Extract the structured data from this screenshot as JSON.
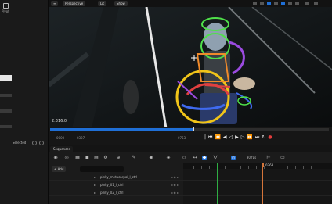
{
  "left_panel": {
    "pivot_label": "Pivot",
    "selected_label": "Selected"
  },
  "viewport": {
    "perspective_label": "Perspective",
    "lit_label": "Lit",
    "show_label": "Show",
    "timecode": "2.316.0",
    "range_start": "0000",
    "range_end": "0327",
    "frame_current": "0753",
    "playback_progress": 0.51
  },
  "sequencer": {
    "tab_label": "Sequencer",
    "add_label": "+ Add",
    "search_placeholder": "",
    "fps_label": "30 fps",
    "playhead_frame": "0768",
    "tracks": [
      {
        "name": "pinky_metacarpal_l_ctrl"
      },
      {
        "name": "pinky_01_l_ctrl"
      },
      {
        "name": "pinky_02_l_ctrl"
      }
    ]
  },
  "colors": {
    "accent": "#1f6fd6",
    "playhead": "#d5753a",
    "start_marker": "#2fae44",
    "end_marker": "#c03232",
    "gizmo_green": "#4fe04a",
    "gizmo_yellow": "#f0c419",
    "gizmo_blue": "#3f6af0",
    "gizmo_red": "#e04040",
    "gizmo_purple": "#9b4be0",
    "gizmo_orange": "#f08a2a"
  }
}
